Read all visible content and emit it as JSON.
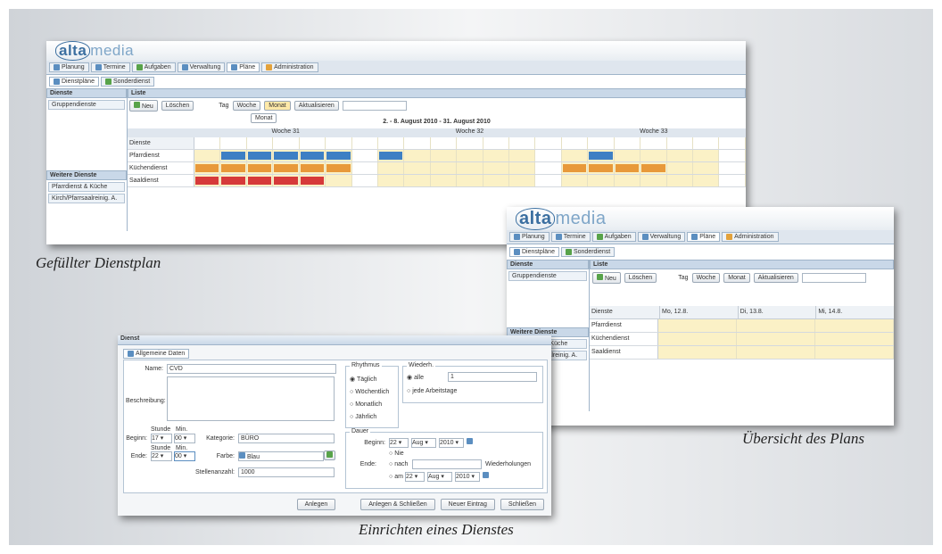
{
  "captions": {
    "filled": "Gefüllter Dienstplan",
    "overview": "Übersicht des Plans",
    "setup": "Einrichten eines Dienstes"
  },
  "app": {
    "logo_prefix": "alta",
    "logo_suffix": "media",
    "tabs": [
      "Planung",
      "Termine",
      "Aufgaben",
      "Verwaltung",
      "Pläne",
      "Administration"
    ],
    "subtabs": [
      "Dienstpläne",
      "Sonderdienst"
    ],
    "sidebar_header_1": "Dienste",
    "sidebar_item_1": "Gruppendienste",
    "sidebar_header_2": "Weitere Dienste",
    "sidebar_items_2": [
      "Pfarrdienst & Küche",
      "Kirch/Pfarrsaalreinig. A."
    ],
    "panel_header": "Liste",
    "btn_new": "Neu",
    "btn_delete": "Löschen",
    "view_label": "Tag",
    "view_opts": [
      "Woche",
      "Monat"
    ],
    "dropdown_item": "Monat",
    "btn_refresh": "Aktualisieren",
    "date_range": "2. - 8. August 2010 - 31. August 2010",
    "week_labels": [
      "Woche 31",
      "Woche 32",
      "Woche 33"
    ],
    "dienste_header": "Dienste",
    "rows": [
      "Pfarrdienst",
      "Küchendienst",
      "Saaldienst"
    ],
    "overview_cols": [
      "Mo, 12.8.",
      "Di, 13.8.",
      "Mi, 14.8."
    ]
  },
  "dialog": {
    "title": "Dienst",
    "tab": "Allgemeine Daten",
    "name_label": "Name:",
    "name_value": "CVD",
    "desc_label": "Beschreibung:",
    "begin_label": "Beginn:",
    "end_label": "Ende:",
    "hour_label": "Stunde",
    "min_label": "Min.",
    "begin_h": "17",
    "begin_m": "00",
    "end_h": "22",
    "end_m": "00",
    "category_label": "Kategorie:",
    "category_value": "BÜRO",
    "color_label": "Farbe:",
    "color_value": "Blau",
    "count_label": "Stellenanzahl:",
    "count_value": "1000",
    "recurrence_header": "Rhythmus",
    "recurrence": [
      "Täglich",
      "Wöchentlich",
      "Monatlich",
      "Jährlich"
    ],
    "repeat_header": "Wiederh.",
    "repeat_opts": [
      "alle",
      "jede Arbeitstage"
    ],
    "repeat_value": "1",
    "duration_header": "Dauer",
    "duration_begin": "Beginn:",
    "duration_end": "Ende:",
    "never": "Nie",
    "after": "nach",
    "at": "am",
    "repeats": "Wiederholungen",
    "date_d": "22",
    "date_m": "Aug",
    "date_y": "2010",
    "buttons": [
      "Anlegen",
      "Anlegen & Schließen",
      "Neuer Eintrag",
      "Schließen"
    ]
  }
}
